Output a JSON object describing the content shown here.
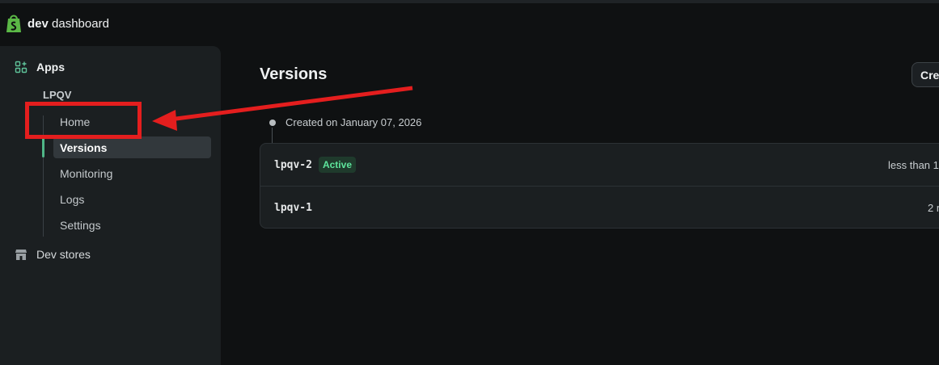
{
  "header": {
    "brand_bold": "dev",
    "brand_rest": " dashboard",
    "logo_icon": "shopify-bag-icon",
    "logo_color": "#5bb846"
  },
  "sidebar": {
    "apps_label": "Apps",
    "apps_icon": "apps-grid-icon",
    "app_name": "LPQV",
    "items": [
      {
        "label": "Home",
        "active": false
      },
      {
        "label": "Versions",
        "active": true
      },
      {
        "label": "Monitoring",
        "active": false
      },
      {
        "label": "Logs",
        "active": false
      },
      {
        "label": "Settings",
        "active": false
      }
    ],
    "dev_stores_label": "Dev stores",
    "dev_stores_icon": "store-icon"
  },
  "main": {
    "title": "Versions",
    "create_button_label": "Cre",
    "group": {
      "created_label": "Created on January 07, 2026",
      "versions": [
        {
          "name": "lpqv-2",
          "badge": "Active",
          "time": "less than 1"
        },
        {
          "name": "lpqv-1",
          "badge": "",
          "time": "2 m"
        }
      ]
    }
  },
  "colors": {
    "accent_green": "#4fb687",
    "badge_green": "#5ee59c",
    "annotation_red": "#e41e1e"
  }
}
